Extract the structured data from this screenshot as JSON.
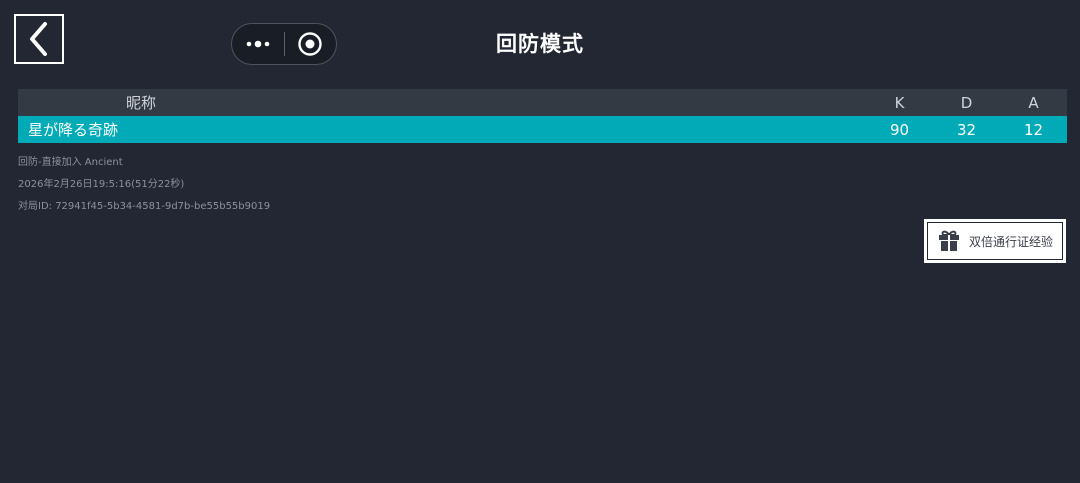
{
  "header": {
    "title": "回防模式",
    "back_icon": "chevron-left-icon",
    "more_icon": "more-dots-icon",
    "close_icon": "target-circle-icon"
  },
  "table": {
    "columns": {
      "name": "昵称",
      "k": "K",
      "d": "D",
      "a": "A"
    },
    "rows": [
      {
        "name": "星が降る奇跡",
        "k": "90",
        "d": "32",
        "a": "12"
      }
    ],
    "highlight_color": "#00abb7"
  },
  "match": {
    "mode_map": "回防-直接加入 Ancient",
    "time": "2026年2月26日19:5:16(51分22秒)",
    "match_id": "对局ID: 72941f45-5b34-4581-9d7b-be55b55b9019"
  },
  "actions": {
    "double_xp_label": "双倍通行证经验",
    "double_xp_icon": "gift-icon"
  },
  "colors": {
    "background": "#222733",
    "header_row": "#343a44",
    "accent": "#00abb7"
  }
}
